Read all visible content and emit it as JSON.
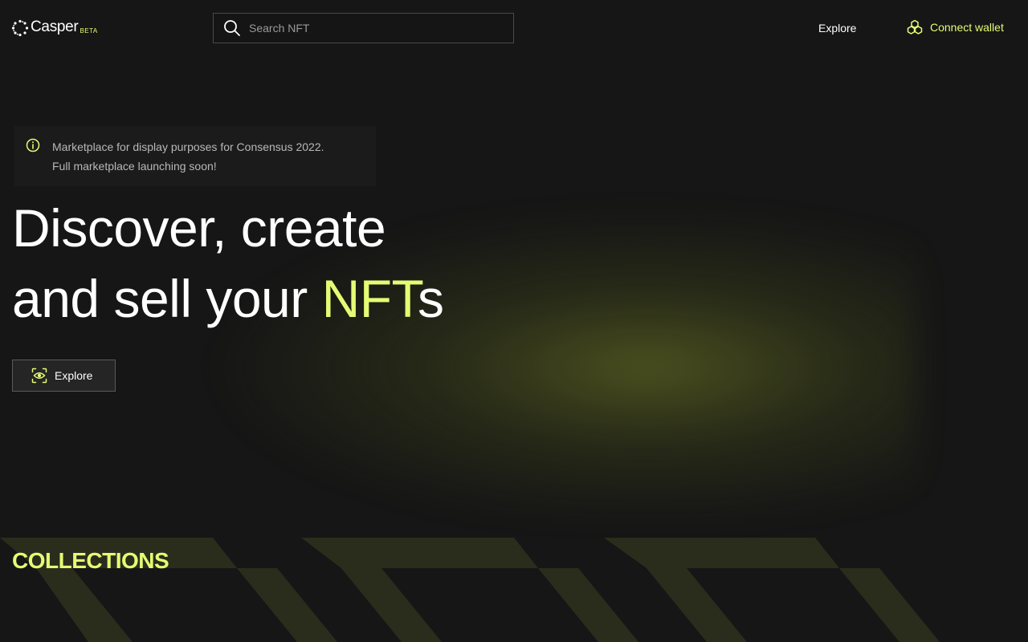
{
  "header": {
    "logo_text": "Casper",
    "logo_badge": "BETA",
    "search_placeholder": "Search NFT",
    "nav_explore": "Explore",
    "connect_wallet": "Connect wallet"
  },
  "notice": {
    "line1": "Marketplace for display purposes for Consensus 2022.",
    "line2": "Full marketplace launching soon!"
  },
  "hero": {
    "line1": "Discover, create",
    "line2_prefix": "and sell your ",
    "line2_accent": "NFT",
    "line2_suffix": "s",
    "explore_button": "Explore"
  },
  "collections": {
    "title": "COLLECTIONS"
  },
  "colors": {
    "background": "#161616",
    "accent": "#e5fb74",
    "notice_bg": "#1b1b1b",
    "button_bg": "#252525"
  },
  "icons": {
    "logo": "casper-logo-icon",
    "search": "search-icon",
    "wallet": "wallet-icon",
    "info": "info-icon",
    "explore": "eye-icon"
  }
}
